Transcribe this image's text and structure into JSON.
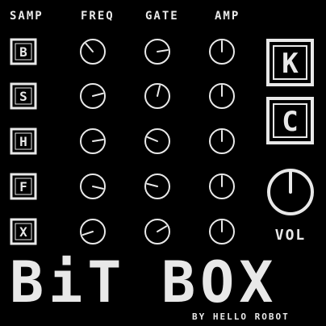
{
  "theme": {
    "foreground": "#e8e8e8",
    "background": "#000000"
  },
  "headers": {
    "samp": "SAMP",
    "freq": "FREQ",
    "gate": "GATE",
    "amp": "AMP"
  },
  "samples": [
    {
      "letter": "B",
      "freq": 0.35,
      "gate": 0.8,
      "amp": 0.5
    },
    {
      "letter": "S",
      "freq": 0.78,
      "gate": 0.55,
      "amp": 0.5
    },
    {
      "letter": "H",
      "freq": 0.8,
      "gate": 0.25,
      "amp": 0.5
    },
    {
      "letter": "F",
      "freq": 0.88,
      "gate": 0.22,
      "amp": 0.5
    },
    {
      "letter": "X",
      "freq": 0.1,
      "gate": 0.72,
      "amp": 0.5
    }
  ],
  "side_buttons": [
    {
      "letter": "K"
    },
    {
      "letter": "C"
    }
  ],
  "volume": {
    "label": "VOL",
    "value": 0.5
  },
  "title": {
    "word1": "BiT",
    "word2": "BOX"
  },
  "byline": "BY HELLO ROBOT"
}
